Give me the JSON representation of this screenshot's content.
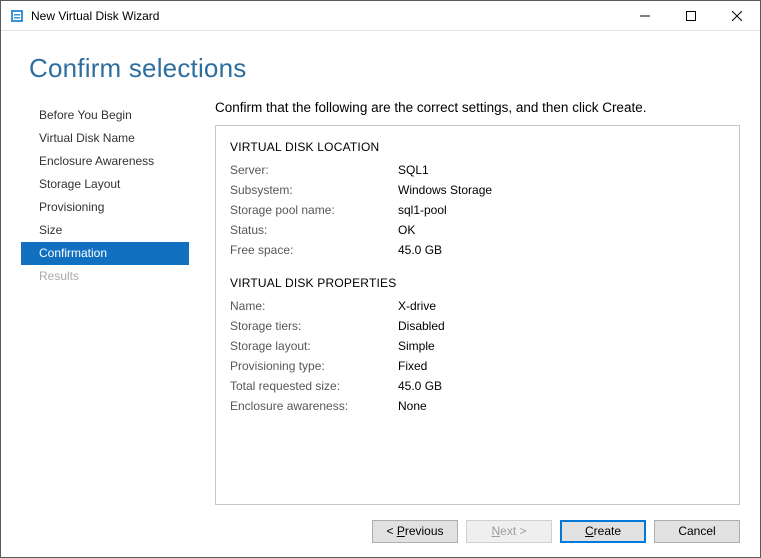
{
  "window": {
    "title": "New Virtual Disk Wizard"
  },
  "heading": "Confirm selections",
  "sidebar": {
    "items": [
      {
        "label": "Before You Begin"
      },
      {
        "label": "Virtual Disk Name"
      },
      {
        "label": "Enclosure Awareness"
      },
      {
        "label": "Storage Layout"
      },
      {
        "label": "Provisioning"
      },
      {
        "label": "Size"
      },
      {
        "label": "Confirmation"
      },
      {
        "label": "Results"
      }
    ]
  },
  "content": {
    "instruction": "Confirm that the following are the correct settings, and then click Create.",
    "location_title": "VIRTUAL DISK LOCATION",
    "location": {
      "server_label": "Server:",
      "server": "SQL1",
      "subsystem_label": "Subsystem:",
      "subsystem": "Windows Storage",
      "pool_label": "Storage pool name:",
      "pool": "sql1-pool",
      "status_label": "Status:",
      "status": "OK",
      "free_label": "Free space:",
      "free": "45.0 GB"
    },
    "properties_title": "VIRTUAL DISK PROPERTIES",
    "properties": {
      "name_label": "Name:",
      "name": "X-drive",
      "tiers_label": "Storage tiers:",
      "tiers": "Disabled",
      "layout_label": "Storage layout:",
      "layout": "Simple",
      "prov_label": "Provisioning type:",
      "prov": "Fixed",
      "size_label": "Total requested size:",
      "size": "45.0 GB",
      "enc_label": "Enclosure awareness:",
      "enc": "None"
    }
  },
  "buttons": {
    "previous": "revious",
    "next": "ext >",
    "create": "reate",
    "cancel": "Cancel"
  }
}
